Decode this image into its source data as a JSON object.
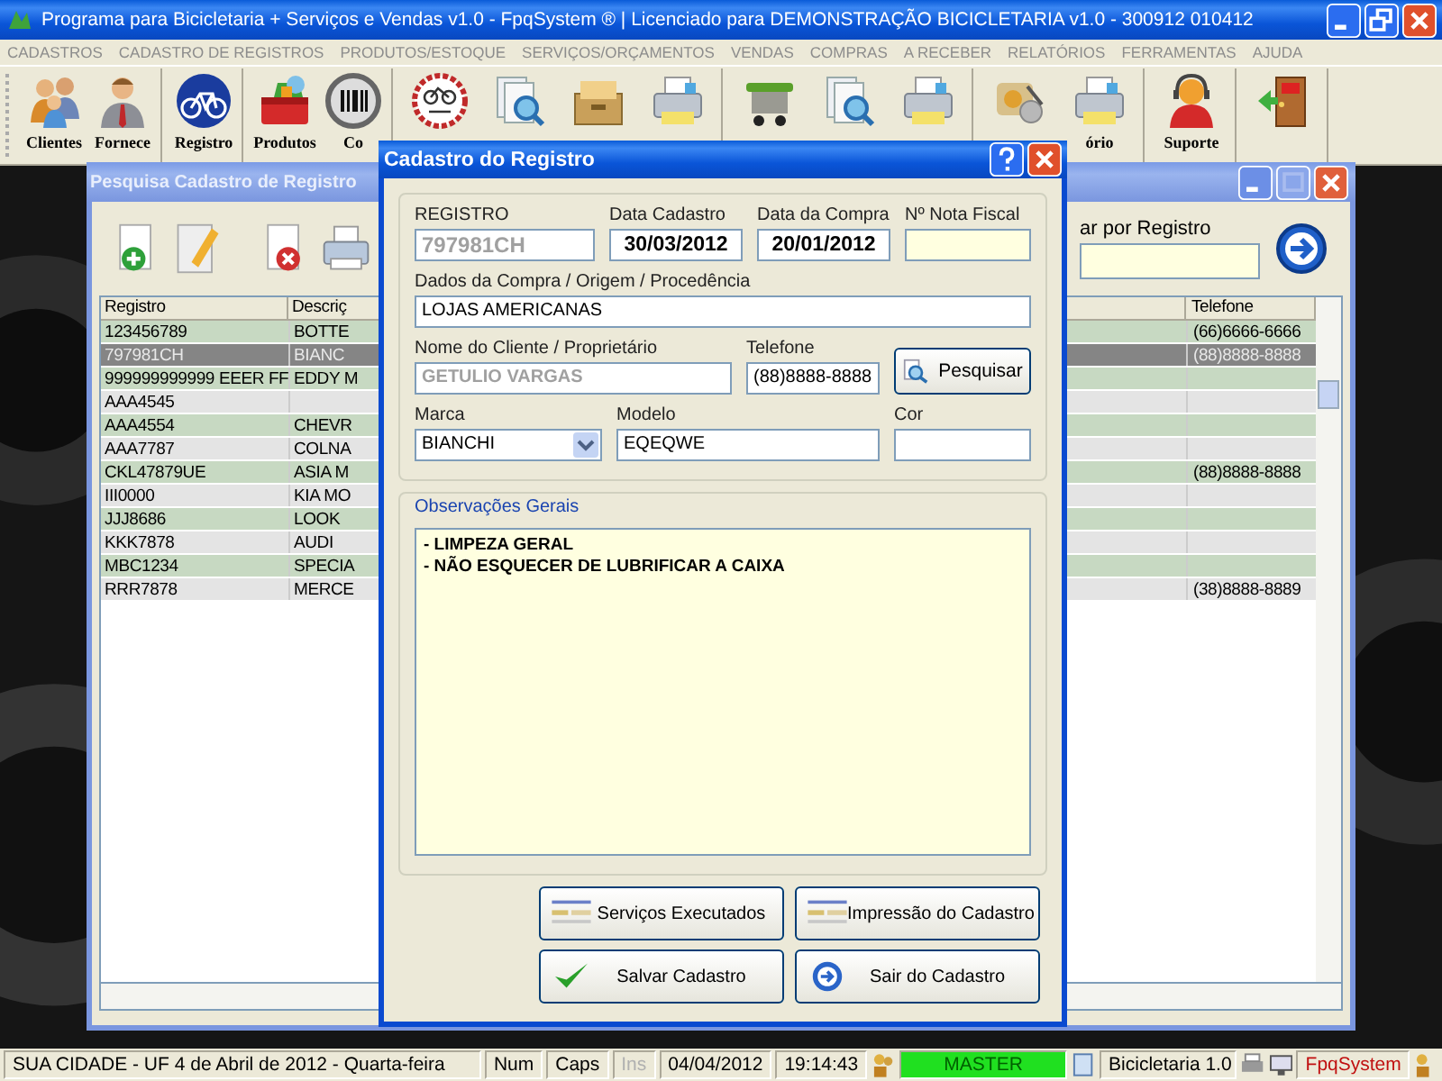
{
  "window": {
    "title": "Programa para Bicicletaria + Serviços e Vendas v1.0 - FpqSystem ® | Licenciado para  DEMONSTRAÇÃO BICICLETARIA v1.0 - 300912 010412"
  },
  "menu": [
    {
      "label": "CADASTROS"
    },
    {
      "label": "CADASTRO DE REGISTROS"
    },
    {
      "label": "PRODUTOS/ESTOQUE"
    },
    {
      "label": "SERVIÇOS/ORÇAMENTOS"
    },
    {
      "label": "VENDAS"
    },
    {
      "label": "COMPRAS"
    },
    {
      "label": "A RECEBER"
    },
    {
      "label": "RELATÓRIOS"
    },
    {
      "label": "FERRAMENTAS"
    },
    {
      "label": "AJUDA"
    }
  ],
  "toolbar_groups": [
    [
      {
        "kind": "people",
        "label": "Clientes"
      },
      {
        "kind": "person",
        "label": "Fornece"
      }
    ],
    [
      {
        "kind": "bicycle",
        "label": "Registro"
      }
    ],
    [
      {
        "kind": "toolbox",
        "label": "Produtos"
      },
      {
        "kind": "barcode",
        "label": "Co"
      }
    ],
    [
      {
        "kind": "bike-service"
      },
      {
        "kind": "search-doc"
      },
      {
        "kind": "drawer"
      },
      {
        "kind": "printer"
      }
    ],
    [
      {
        "kind": "cart"
      },
      {
        "kind": "search-doc"
      },
      {
        "kind": "printer"
      }
    ],
    [
      {
        "kind": "money"
      },
      {
        "kind": "printer",
        "label": "ório"
      }
    ],
    [
      {
        "kind": "support",
        "label": "Suporte"
      }
    ],
    [
      {
        "kind": "exit"
      }
    ]
  ],
  "search_window": {
    "title": "Pesquisa Cadastro de Registro",
    "search_label": "ar por Registro",
    "columns": [
      "Registro",
      "Descriç",
      "Telefone"
    ],
    "rows": [
      {
        "registro": "123456789",
        "descricao": "BOTTE",
        "telefone": "(66)6666-6666",
        "selected": false
      },
      {
        "registro": "797981CH",
        "descricao": "BIANC",
        "telefone": "(88)8888-8888",
        "selected": true
      },
      {
        "registro": "999999999999 EEER FF",
        "descricao": "EDDY M",
        "selected": false
      },
      {
        "registro": "AAA4545",
        "selected": false
      },
      {
        "registro": "AAA4554",
        "descricao": "CHEVR",
        "selected": false
      },
      {
        "registro": "AAA7787",
        "descricao": "COLNA",
        "selected": false
      },
      {
        "registro": "CKL47879UE",
        "descricao": "ASIA M",
        "telefone": "(88)8888-8888",
        "selected": false
      },
      {
        "registro": "III0000",
        "descricao": "KIA MO",
        "selected": false
      },
      {
        "registro": "JJJ8686",
        "descricao": "LOOK",
        "selected": false
      },
      {
        "registro": "KKK7878",
        "descricao": "AUDI",
        "selected": false
      },
      {
        "registro": "MBC1234",
        "descricao": "SPECIA",
        "selected": false
      },
      {
        "registro": "RRR7878",
        "descricao": "MERCE",
        "telefone": "(38)8888-8889",
        "selected": false
      }
    ]
  },
  "dialog": {
    "title": "Cadastro do Registro",
    "registro": {
      "label": "REGISTRO",
      "value": "797981CH",
      "disabled": true
    },
    "data_cadastro": {
      "label": "Data Cadastro",
      "value": "30/03/2012",
      "disabled": false
    },
    "data_compra": {
      "label": "Data da Compra",
      "value": "20/01/2012",
      "disabled": false
    },
    "nota_fiscal": {
      "label": "Nº Nota Fiscal"
    },
    "origem": {
      "label": "Dados da Compra / Origem / Procedência",
      "value": "LOJAS AMERICANAS",
      "disabled": false
    },
    "cliente": {
      "label": "Nome do Cliente / Proprietário",
      "value": "GETULIO VARGAS",
      "disabled": true
    },
    "telefone": {
      "label": "Telefone",
      "value": "(88)8888-8888",
      "disabled": false
    },
    "pesquisar": "Pesquisar",
    "marca": {
      "label": "Marca",
      "value": "BIANCHI",
      "disabled": false
    },
    "modelo": {
      "label": "Modelo",
      "value": "EQEQWE",
      "disabled": false
    },
    "cor": {
      "label": "Cor"
    },
    "observacoes": {
      "label": "Observações Gerais",
      "lines": [
        "- LIMPEZA GERAL",
        "- NÃO ESQUECER DE LUBRIFICAR A CAIXA"
      ]
    },
    "buttons": [
      {
        "label": "Serviços Executados",
        "kind": "list"
      },
      {
        "label": "Impressão do Cadastro",
        "kind": "list"
      },
      {
        "label": "Salvar Cadastro",
        "kind": "save"
      },
      {
        "label": "Sair do Cadastro",
        "kind": "exit"
      }
    ]
  },
  "status_bar": [
    {
      "text": "SUA CIDADE - UF  4 de Abril de 2012 - Quarta-feira",
      "kind": "text",
      "disabled": false
    },
    {
      "text": "Num",
      "kind": "text",
      "disabled": false
    },
    {
      "text": "Caps",
      "kind": "text",
      "disabled": false
    },
    {
      "text": "Ins",
      "kind": "text",
      "disabled": true
    },
    {
      "text": "04/04/2012",
      "kind": "text",
      "disabled": false
    },
    {
      "text": "19:14:43",
      "kind": "text",
      "disabled": false
    },
    {
      "text": "MASTER",
      "kind": "user",
      "disabled": false
    },
    {
      "text": "Bicicletaria 1.0",
      "kind": "app",
      "disabled": false
    },
    {
      "text": "FpqSystem",
      "kind": "brand",
      "disabled": false
    }
  ]
}
